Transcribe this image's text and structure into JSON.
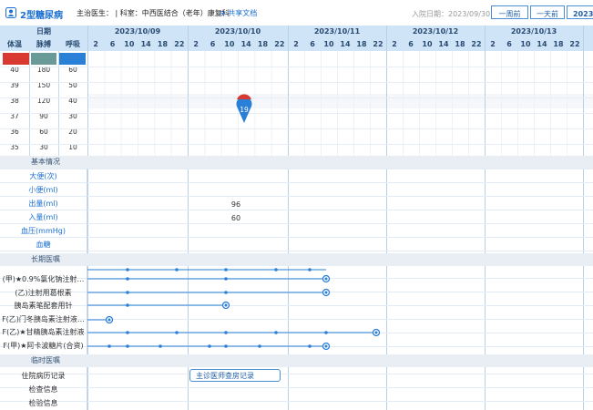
{
  "app": {
    "name": "2型糖尿病",
    "doctor": "主治医生：",
    "dept": "科室：中西医结合（老年）康复科",
    "share": "共享文档",
    "admit_label": "入院日期：2023/09/30"
  },
  "nav": {
    "prev_week": "一周前",
    "prev_day": "一天前",
    "year": "2023"
  },
  "header": {
    "date_label": "日期",
    "vitals": [
      "体温",
      "脉搏",
      "呼吸"
    ],
    "hours": [
      "2",
      "6",
      "10",
      "14",
      "18",
      "22"
    ]
  },
  "dates": [
    "2023/10/09",
    "2023/10/10",
    "2023/10/11",
    "2023/10/12",
    "2023/10/13"
  ],
  "legend_colors": [
    "#d83a32",
    "#6a9a98",
    "#2a7fd6"
  ],
  "scales": {
    "temp": [
      "40",
      "39",
      "38",
      "37",
      "36",
      "35"
    ],
    "pulse": [
      "180",
      "150",
      "120",
      "90",
      "60",
      "30"
    ],
    "resp": [
      "60",
      "50",
      "40",
      "30",
      "20",
      "10"
    ]
  },
  "marker": {
    "label": "19",
    "color_top": "#d83a32",
    "color_bottom": "#2a7fd6"
  },
  "sections": {
    "basic": "基本情况",
    "long_term": "长期医嘱",
    "temporary": "临时医嘱"
  },
  "basic_rows": [
    "大便(次)",
    "小便(ml)",
    "出量(ml)",
    "入量(ml)",
    "血压(mmHg)",
    "血糖"
  ],
  "values": {
    "output": "96",
    "intake": "60"
  },
  "orders": [
    "(甲)★0.9%氯化钠注射…",
    "(乙)注射用葛根素",
    "胰岛素笔配套用针",
    "F(乙)门冬胰岛素注射液…",
    "F(乙)★甘精胰岛素注射液",
    "F(甲)★阿卡波糖片(合资)"
  ],
  "temp_rows": [
    "住院病历记录",
    "检查信息",
    "检验信息"
  ],
  "record_tag": "主诊医师查房记录"
}
